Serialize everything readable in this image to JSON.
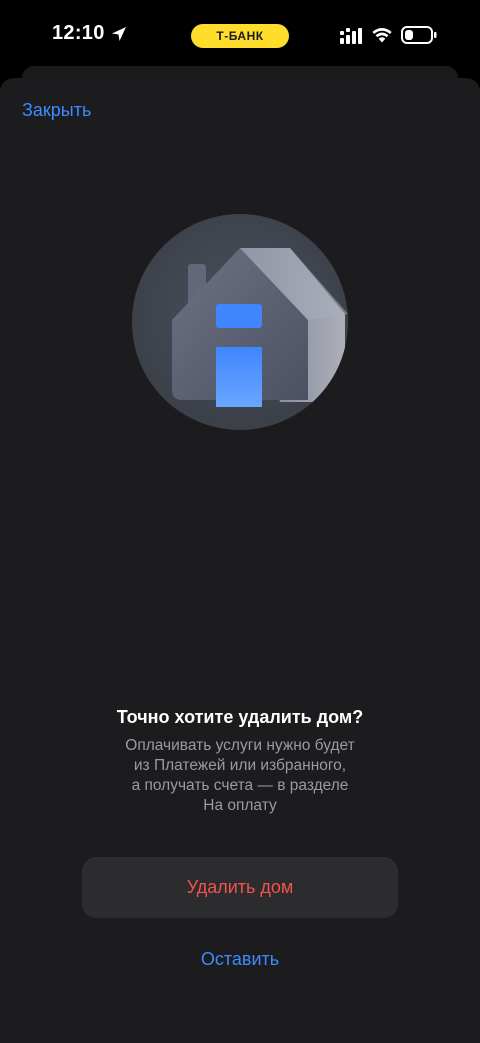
{
  "status_bar": {
    "time": "12:10",
    "carrier_badge": "Т-БАНК"
  },
  "sheet": {
    "close_label": "Закрыть"
  },
  "illustration": {
    "icon": "house-icon"
  },
  "dialog": {
    "title": "Точно хотите удалить дом?",
    "message_lines": [
      "Оплачивать услуги нужно будет",
      "из Платежей или избранного,",
      "а получать счета — в разделе",
      "На оплату"
    ],
    "delete_label": "Удалить дом",
    "keep_label": "Оставить"
  },
  "colors": {
    "accent_blue": "#3d8bff",
    "destructive_red": "#f2524c",
    "brand_yellow": "#ffdd2d",
    "sheet_background": "#1c1c1e"
  }
}
